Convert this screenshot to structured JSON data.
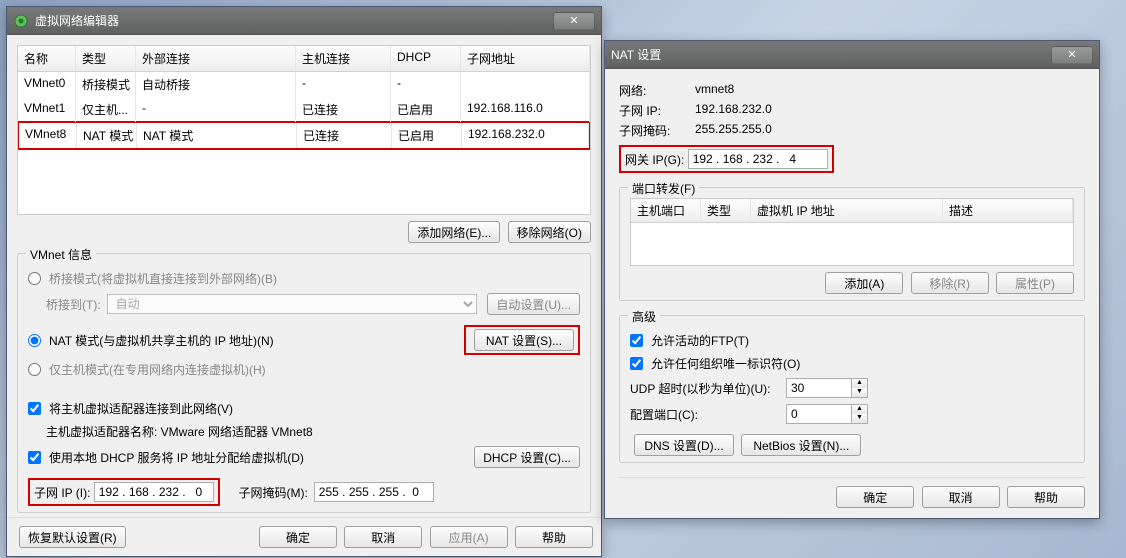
{
  "editor": {
    "title": "虚拟网络编辑器",
    "columns": {
      "name": "名称",
      "type": "类型",
      "ext": "外部连接",
      "host": "主机连接",
      "dhcp": "DHCP",
      "addr": "子网地址"
    },
    "rows": [
      {
        "name": "VMnet0",
        "type": "桥接模式",
        "ext": "自动桥接",
        "host": "-",
        "dhcp": "-",
        "addr": ""
      },
      {
        "name": "VMnet1",
        "type": "仅主机...",
        "ext": "-",
        "host": "已连接",
        "dhcp": "已启用",
        "addr": "192.168.116.0"
      },
      {
        "name": "VMnet8",
        "type": "NAT 模式",
        "ext": "NAT 模式",
        "host": "已连接",
        "dhcp": "已启用",
        "addr": "192.168.232.0"
      }
    ],
    "buttons": {
      "add_net": "添加网络(E)...",
      "remove_net": "移除网络(O)"
    },
    "info_title": "VMnet 信息",
    "bridge_radio": "桥接模式(将虚拟机直接连接到外部网络)(B)",
    "bridge_to_label": "桥接到(T):",
    "bridge_to_value": "自动",
    "bridge_auto_btn": "自动设置(U)...",
    "nat_radio": "NAT 模式(与虚拟机共享主机的 IP 地址)(N)",
    "nat_settings_btn": "NAT 设置(S)...",
    "hostonly_radio": "仅主机模式(在专用网络内连接虚拟机)(H)",
    "connect_host_check": "将主机虚拟适配器连接到此网络(V)",
    "adapter_name_line": "主机虚拟适配器名称: VMware 网络适配器 VMnet8",
    "dhcp_check": "使用本地 DHCP 服务将 IP 地址分配给虚拟机(D)",
    "dhcp_btn": "DHCP 设置(C)...",
    "subnet_ip_label": "子网 IP (I):",
    "subnet_ip_value": "192 . 168 . 232 .   0",
    "subnet_mask_label": "子网掩码(M):",
    "subnet_mask_value": "255 . 255 . 255 .  0",
    "restore_btn": "恢复默认设置(R)",
    "ok_btn": "确定",
    "cancel_btn": "取消",
    "apply_btn": "应用(A)",
    "help_btn": "帮助"
  },
  "nat": {
    "title": "NAT 设置",
    "network_label": "网络:",
    "network_value": "vmnet8",
    "subnet_ip_label": "子网 IP:",
    "subnet_ip_value": "192.168.232.0",
    "subnet_mask_label": "子网掩码:",
    "subnet_mask_value": "255.255.255.0",
    "gateway_label": "网关 IP(G):",
    "gateway_value": "192 . 168 . 232 .   4",
    "portfwd_title": "端口转发(F)",
    "pf_cols": {
      "hostport": "主机端口",
      "type": "类型",
      "vmip": "虚拟机 IP 地址",
      "desc": "描述"
    },
    "pf_add": "添加(A)",
    "pf_remove": "移除(R)",
    "pf_props": "属性(P)",
    "adv_title": "高级",
    "active_ftp": "允许活动的FTP(T)",
    "any_oui": "允许任何组织唯一标识符(O)",
    "udp_timeout_label": "UDP 超时(以秒为单位)(U):",
    "udp_timeout_value": "30",
    "config_port_label": "配置端口(C):",
    "config_port_value": "0",
    "dns_btn": "DNS 设置(D)...",
    "netbios_btn": "NetBios 设置(N)...",
    "ok_btn": "确定",
    "cancel_btn": "取消",
    "help_btn": "帮助"
  }
}
